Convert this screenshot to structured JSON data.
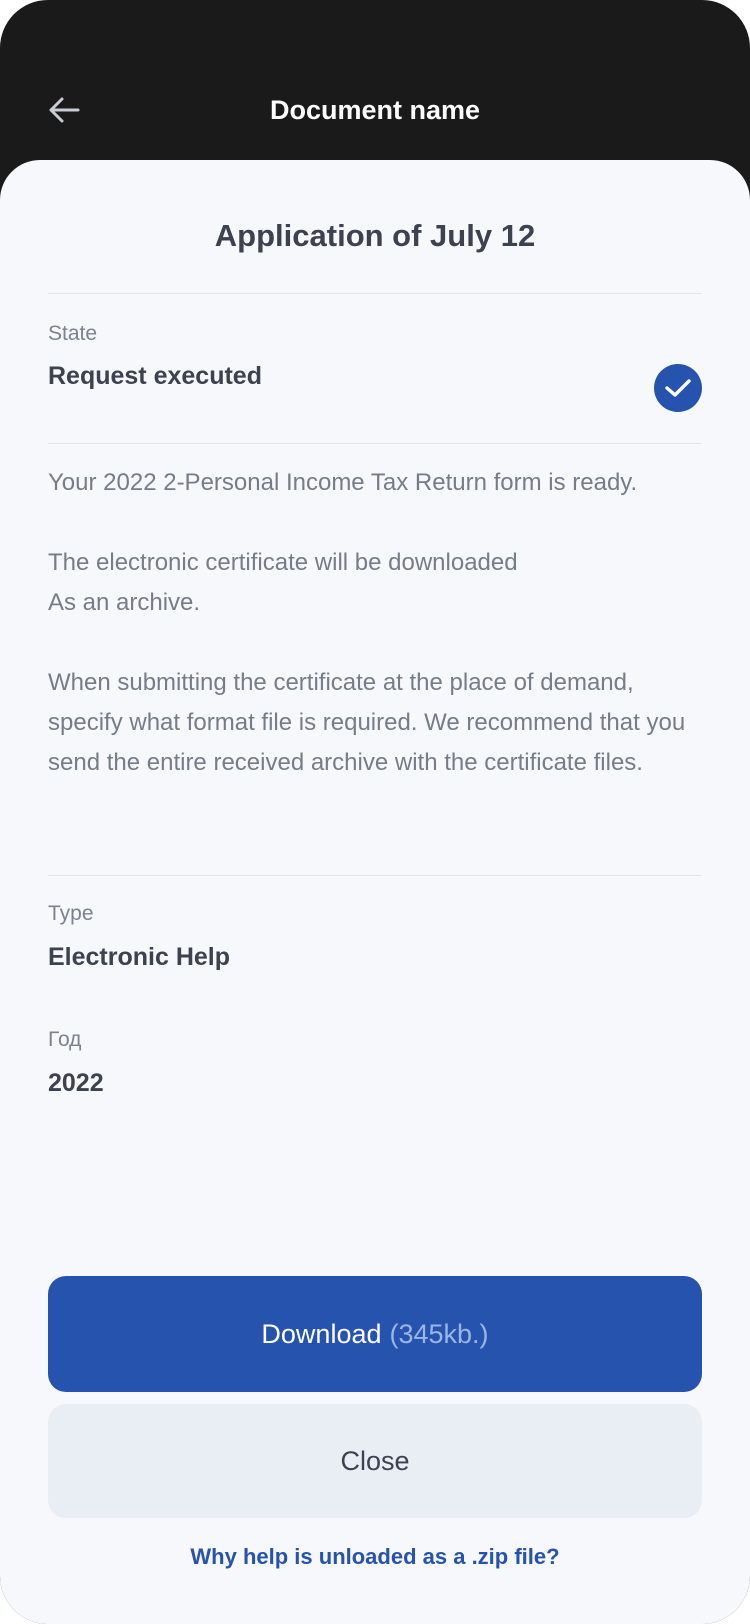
{
  "header": {
    "title": "Document name",
    "back_icon": "arrow-left-icon"
  },
  "document": {
    "title": "Application of July 12",
    "state_label": "State",
    "state_value": "Request executed",
    "state_icon": "check-circle-icon",
    "paragraph1": "Your 2022 2-Personal Income Tax Return form is ready.",
    "paragraph2_line1": "The electronic certificate will be downloaded",
    "paragraph2_line2": "As an archive.",
    "paragraph3": "When submitting the certificate at the place of demand, specify what format file is required. We recommend that you send the entire received archive with the certificate files.",
    "type_label": "Type",
    "type_value": "Electronic Help",
    "year_label": "Год",
    "year_value": "2022"
  },
  "actions": {
    "download_label": "Download",
    "download_size": "(345kb.)",
    "close_label": "Close",
    "help_link": "Why help is unloaded as a .zip file?"
  },
  "colors": {
    "accent": "#2653ae",
    "header_bg": "#1a1a1a",
    "sheet_bg": "#f6f8fb",
    "close_bg": "#e9edf4"
  }
}
